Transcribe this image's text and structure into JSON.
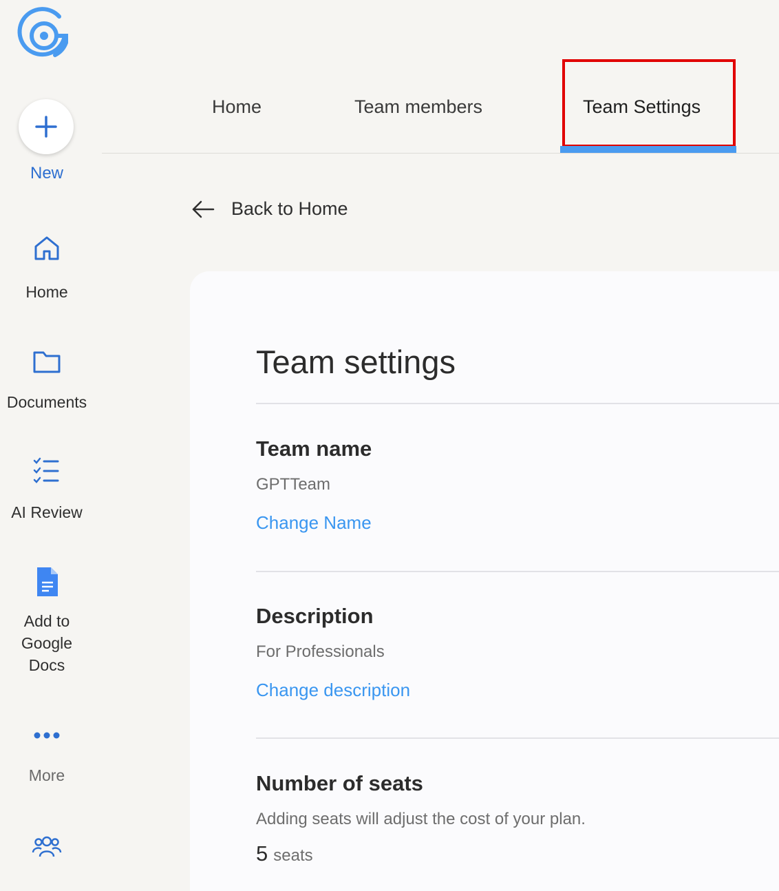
{
  "colors": {
    "accent": "#4a9bf0",
    "link": "#3a96f0",
    "highlight": "#e10000",
    "background": "#f6f5f2",
    "card": "#fbfbfd"
  },
  "sidebar": {
    "logo_icon": "target-logo-icon",
    "new": {
      "icon": "plus-icon",
      "label": "New"
    },
    "items": [
      {
        "icon": "home-icon",
        "label": "Home"
      },
      {
        "icon": "folder-icon",
        "label": "Documents"
      },
      {
        "icon": "checklist-icon",
        "label": "AI Review"
      },
      {
        "icon": "google-docs-icon",
        "label": "Add to Google Docs"
      },
      {
        "icon": "more-dots-icon",
        "label": "More"
      },
      {
        "icon": "team-icon",
        "label": ""
      }
    ]
  },
  "tabs": [
    {
      "label": "Home",
      "active": false
    },
    {
      "label": "Team members",
      "active": false
    },
    {
      "label": "Team Settings",
      "active": true
    }
  ],
  "back": {
    "icon": "arrow-left-icon",
    "label": "Back to Home"
  },
  "settings": {
    "title": "Team settings",
    "team_name": {
      "heading": "Team name",
      "value": "GPTTeam",
      "action": "Change Name"
    },
    "description": {
      "heading": "Description",
      "value": "For Professionals",
      "action": "Change description"
    },
    "seats": {
      "heading": "Number of seats",
      "note": "Adding seats will adjust the cost of your plan.",
      "count": "5",
      "unit": "seats"
    }
  }
}
